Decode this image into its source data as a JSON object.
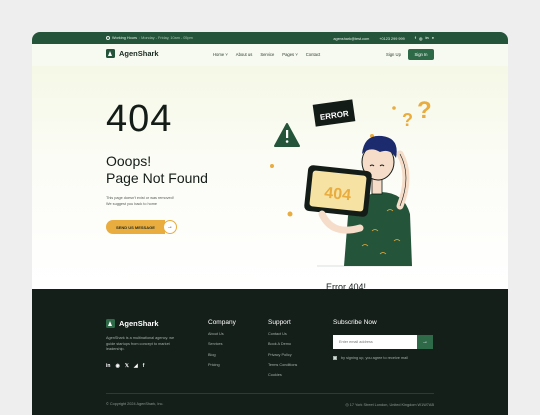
{
  "topbar": {
    "hours_label": "Working Hours",
    "hours_value": ": Monday - Friday, 10am - 05pm",
    "email": "agenshark@test.com",
    "phone": "+0123 299 999",
    "socials": [
      "f",
      "◎",
      "in",
      "●"
    ]
  },
  "nav": {
    "brand": "AgenShark",
    "menu": [
      "Home ˅",
      "About us",
      "Service",
      "Pages ˅",
      "Contact"
    ],
    "signup": "Sign Up",
    "signin": "Sign In"
  },
  "hero": {
    "code": "404",
    "headline_line1": "Ooops!",
    "headline_line2": "Page Not Found",
    "desc_line1": "This page doesn't exist or was removed!",
    "desc_line2": "We suggest you back to home",
    "cta": "SEND US MESSAGE",
    "cta_arrow": "→",
    "error_sign": "ERROR",
    "screen_text": "404",
    "caption": "Error 404!"
  },
  "footer": {
    "brand": "AgenShark",
    "desc": "AgenShark is a multinational agency. we guide startups from concept to market leadership.",
    "socials": [
      "in",
      "◉",
      "𝕏",
      "◢",
      "f"
    ],
    "company": {
      "title": "Company",
      "links": [
        "About Us",
        "Services",
        "Blog",
        "Pricing"
      ]
    },
    "support": {
      "title": "Support",
      "links": [
        "Contact Us",
        "Book A Demo",
        "Privacy Policy",
        "Terms Conditions",
        "Cookies"
      ]
    },
    "subscribe": {
      "title": "Subscribe Now",
      "placeholder": "Enter email address",
      "button": "→",
      "agree": "by signing up, you agree to receive mail"
    },
    "copyright": "© Copyright 2024 AgenShark, Inc.",
    "address": "◎ 17 York Street London, United Kingdom W1W7AB"
  },
  "colors": {
    "brand_green": "#245439",
    "accent_yellow": "#e8ac3f",
    "footer_bg": "#151f1a"
  }
}
